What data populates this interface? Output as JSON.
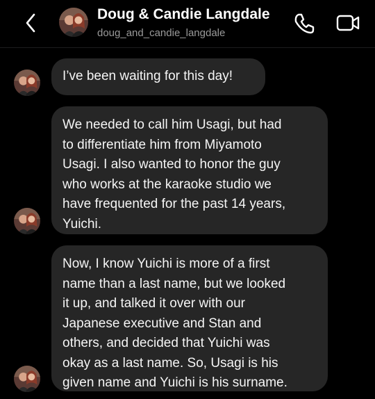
{
  "header": {
    "contact_name": "Doug & Candie Langdale",
    "contact_handle": "doug_and_candie_langdale",
    "icons": {
      "back": "chevron-left-icon",
      "call": "phone-icon",
      "video": "video-camera-icon"
    }
  },
  "messages": [
    {
      "text": "I’ve been waiting for this day!"
    },
    {
      "text": "We needed to call him Usagi, but had\nto differentiate him from Miyamoto\nUsagi. I also wanted to honor the guy\nwho works at the karaoke studio we\nhave frequented for the past 14 years,\nYuichi."
    },
    {
      "text": "Now, I know Yuichi is more of a first\nname than a last name, but we looked\nit up, and talked it over with our\nJapanese executive and Stan and\nothers, and decided that Yuichi was\nokay as a last name. So, Usagi is his\ngiven name and Yuichi is his surname."
    }
  ],
  "colors": {
    "background": "#000000",
    "bubble": "#262626",
    "text": "#f5f5f5",
    "subtext": "#9a9a9a"
  }
}
